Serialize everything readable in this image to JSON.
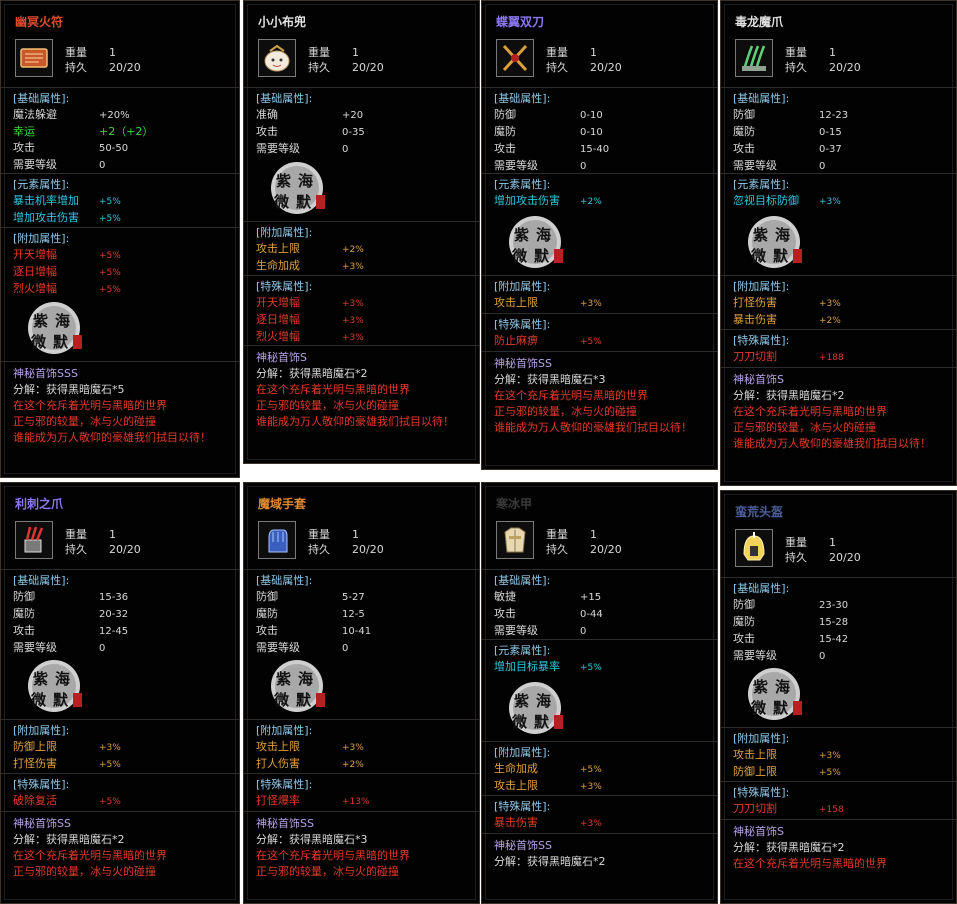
{
  "items": [
    {
      "name": "幽冥火符",
      "name_color": "#e04c2c",
      "icon": "scroll-icon",
      "weight_label": "重量",
      "weight": "1",
      "durability_label": "持久",
      "durability": "20/20",
      "base_header": "[基础属性]:",
      "base": [
        {
          "k": "魔法躲避",
          "v": "+20%",
          "cls": "white"
        },
        {
          "k": "幸运",
          "v": "+2（+2）",
          "cls": "green"
        },
        {
          "k": "攻击",
          "v": "50-50",
          "cls": "white"
        },
        {
          "k": "需要等级",
          "v": "0",
          "cls": "white"
        }
      ],
      "elem_header": "[元素属性]:",
      "elem": [
        {
          "k": "暴击机率增加",
          "v": "+5%"
        },
        {
          "k": "增加攻击伤害",
          "v": "+5%"
        }
      ],
      "extra_header": "[附加属性]:",
      "extra": [
        {
          "k": "开天增幅",
          "v": "+5%"
        },
        {
          "k": "逐日增幅",
          "v": "+5%"
        },
        {
          "k": "烈火增幅",
          "v": "+5%"
        }
      ],
      "special_header": "",
      "special": [],
      "footer_title": "神秘首饰SSS",
      "decompose": "分解：获得黑暗魔石*5",
      "flavor": [
        "在这个充斥着光明与黑暗的世界",
        "正与邪的较量，冰与火的碰撞",
        "谁能成为万人敬仰的豪雄我们拭目以待！"
      ]
    },
    {
      "name": "小小布兜",
      "name_color": "#e0e0e0",
      "icon": "bag-icon",
      "weight_label": "重量",
      "weight": "1",
      "durability_label": "持久",
      "durability": "20/20",
      "base_header": "[基础属性]:",
      "base": [
        {
          "k": "准确",
          "v": "+20",
          "cls": "white"
        },
        {
          "k": "攻击",
          "v": "0-35",
          "cls": "white"
        },
        {
          "k": "需要等级",
          "v": "0",
          "cls": "white"
        }
      ],
      "elem_header": "",
      "elem": [],
      "extra_header": "[附加属性]:",
      "extra": [
        {
          "k": "攻击上限",
          "v": "+2%"
        },
        {
          "k": "生命加成",
          "v": "+3%"
        }
      ],
      "special_header": "[特殊属性]:",
      "special": [
        {
          "k": "开天增幅",
          "v": "+3%"
        },
        {
          "k": "逐日增幅",
          "v": "+3%"
        },
        {
          "k": "烈火增幅",
          "v": "+3%"
        }
      ],
      "footer_title": "神秘首饰S",
      "decompose": "分解：获得黑暗魔石*2",
      "flavor": [
        "在这个充斥着光明与黑暗的世界",
        "正与邪的较量，冰与火的碰撞",
        "谁能成为万人敬仰的豪雄我们拭目以待！"
      ]
    },
    {
      "name": "蝶翼双刀",
      "name_color": "#8c78f0",
      "icon": "twin-blades-icon",
      "weight_label": "重量",
      "weight": "1",
      "durability_label": "持久",
      "durability": "20/20",
      "base_header": "[基础属性]:",
      "base": [
        {
          "k": "防御",
          "v": "0-10",
          "cls": "white"
        },
        {
          "k": "魔防",
          "v": "0-10",
          "cls": "white"
        },
        {
          "k": "攻击",
          "v": "15-40",
          "cls": "white"
        },
        {
          "k": "需要等级",
          "v": "0",
          "cls": "white"
        }
      ],
      "elem_header": "[元素属性]:",
      "elem": [
        {
          "k": "增加攻击伤害",
          "v": "+2%"
        }
      ],
      "extra_header": "[附加属性]:",
      "extra": [
        {
          "k": "攻击上限",
          "v": "+3%"
        }
      ],
      "special_header": "[特殊属性]:",
      "special": [
        {
          "k": "防止麻痹",
          "v": "+5%"
        }
      ],
      "footer_title": "神秘首饰SS",
      "decompose": "分解：获得黑暗魔石*3",
      "flavor": [
        "在这个充斥着光明与黑暗的世界",
        "正与邪的较量，冰与火的碰撞",
        "谁能成为万人敬仰的豪雄我们拭目以待！"
      ]
    },
    {
      "name": "毒龙魔爪",
      "name_color": "#e0e0e0",
      "icon": "claw-icon",
      "weight_label": "重量",
      "weight": "1",
      "durability_label": "持久",
      "durability": "20/20",
      "base_header": "[基础属性]:",
      "base": [
        {
          "k": "防御",
          "v": "12-23",
          "cls": "white"
        },
        {
          "k": "魔防",
          "v": "0-15",
          "cls": "white"
        },
        {
          "k": "攻击",
          "v": "0-37",
          "cls": "white"
        },
        {
          "k": "需要等级",
          "v": "0",
          "cls": "white"
        }
      ],
      "elem_header": "[元素属性]:",
      "elem": [
        {
          "k": "忽视目标防御",
          "v": "+3%"
        }
      ],
      "extra_header": "[附加属性]:",
      "extra": [
        {
          "k": "打怪伤害",
          "v": "+3%"
        },
        {
          "k": "暴击伤害",
          "v": "+2%"
        }
      ],
      "special_header": "[特殊属性]:",
      "special": [
        {
          "k": "刀刀切割",
          "v": "+188"
        }
      ],
      "footer_title": "神秘首饰S",
      "decompose": "分解：获得黑暗魔石*2",
      "flavor": [
        "在这个充斥着光明与黑暗的世界",
        "正与邪的较量，冰与火的碰撞",
        "谁能成为万人敬仰的豪雄我们拭目以待！"
      ]
    },
    {
      "name": "利刺之爪",
      "name_color": "#8c78f0",
      "icon": "gauntlet-claw-icon",
      "weight_label": "重量",
      "weight": "1",
      "durability_label": "持久",
      "durability": "20/20",
      "base_header": "[基础属性]:",
      "base": [
        {
          "k": "防御",
          "v": "15-36",
          "cls": "white"
        },
        {
          "k": "魔防",
          "v": "20-32",
          "cls": "white"
        },
        {
          "k": "攻击",
          "v": "12-45",
          "cls": "white"
        },
        {
          "k": "需要等级",
          "v": "0",
          "cls": "white"
        }
      ],
      "elem_header": "",
      "elem": [],
      "extra_header": "[附加属性]:",
      "extra": [
        {
          "k": "防御上限",
          "v": "+3%"
        },
        {
          "k": "打怪伤害",
          "v": "+5%"
        }
      ],
      "special_header": "[特殊属性]:",
      "special": [
        {
          "k": "破除复活",
          "v": "+5%"
        }
      ],
      "footer_title": "神秘首饰SS",
      "decompose": "分解：获得黑暗魔石*2",
      "flavor": [
        "在这个充斥着光明与黑暗的世界",
        "正与邪的较量，冰与火的碰撞"
      ]
    },
    {
      "name": "魔域手套",
      "name_color": "#e08a30",
      "icon": "glove-icon",
      "weight_label": "重量",
      "weight": "1",
      "durability_label": "持久",
      "durability": "20/20",
      "base_header": "[基础属性]:",
      "base": [
        {
          "k": "防御",
          "v": "5-27",
          "cls": "white"
        },
        {
          "k": "魔防",
          "v": "12-5",
          "cls": "white"
        },
        {
          "k": "攻击",
          "v": "10-41",
          "cls": "white"
        },
        {
          "k": "需要等级",
          "v": "0",
          "cls": "white"
        }
      ],
      "elem_header": "",
      "elem": [],
      "extra_header": "[附加属性]:",
      "extra": [
        {
          "k": "攻击上限",
          "v": "+3%"
        },
        {
          "k": "打人伤害",
          "v": "+2%"
        }
      ],
      "special_header": "[特殊属性]:",
      "special": [
        {
          "k": "打怪爆率",
          "v": "+13%"
        }
      ],
      "footer_title": "神秘首饰SS",
      "decompose": "分解：获得黑暗魔石*3",
      "flavor": [
        "在这个充斥着光明与黑暗的世界",
        "正与邪的较量，冰与火的碰撞"
      ]
    },
    {
      "name": "寒冰甲",
      "name_color": "#3a3a3a",
      "icon": "armor-icon",
      "weight_label": "重量",
      "weight": "1",
      "durability_label": "持久",
      "durability": "20/20",
      "base_header": "[基础属性]:",
      "base": [
        {
          "k": "敏捷",
          "v": "+15",
          "cls": "white"
        },
        {
          "k": "攻击",
          "v": "0-44",
          "cls": "white"
        },
        {
          "k": "需要等级",
          "v": "0",
          "cls": "white"
        }
      ],
      "elem_header": "[元素属性]:",
      "elem": [
        {
          "k": "增加目标暴率",
          "v": "+5%"
        }
      ],
      "extra_header": "[附加属性]:",
      "extra": [
        {
          "k": "生命加成",
          "v": "+5%"
        },
        {
          "k": "攻击上限",
          "v": "+3%"
        }
      ],
      "special_header": "[特殊属性]:",
      "special": [
        {
          "k": "暴击伤害",
          "v": "+3%"
        }
      ],
      "footer_title": "神秘首饰SS",
      "decompose": "分解：获得黑暗魔石*2",
      "flavor": []
    },
    {
      "name": "蛮荒头盔",
      "name_color": "#4d5f9a",
      "icon": "helmet-icon",
      "weight_label": "重量",
      "weight": "1",
      "durability_label": "持久",
      "durability": "20/20",
      "base_header": "[基础属性]:",
      "base": [
        {
          "k": "防御",
          "v": "23-30",
          "cls": "white"
        },
        {
          "k": "魔防",
          "v": "15-28",
          "cls": "white"
        },
        {
          "k": "攻击",
          "v": "15-42",
          "cls": "white"
        },
        {
          "k": "需要等级",
          "v": "0",
          "cls": "white"
        }
      ],
      "elem_header": "",
      "elem": [],
      "extra_header": "[附加属性]:",
      "extra": [
        {
          "k": "攻击上限",
          "v": "+3%"
        },
        {
          "k": "防御上限",
          "v": "+5%"
        }
      ],
      "special_header": "[特殊属性]:",
      "special": [
        {
          "k": "刀刀切割",
          "v": "+158"
        }
      ],
      "footer_title": "神秘首饰S",
      "decompose": "分解：获得黑暗魔石*2",
      "flavor": [
        "在这个充斥着光明与黑暗的世界"
      ]
    }
  ],
  "seal_text": "紫海微默"
}
